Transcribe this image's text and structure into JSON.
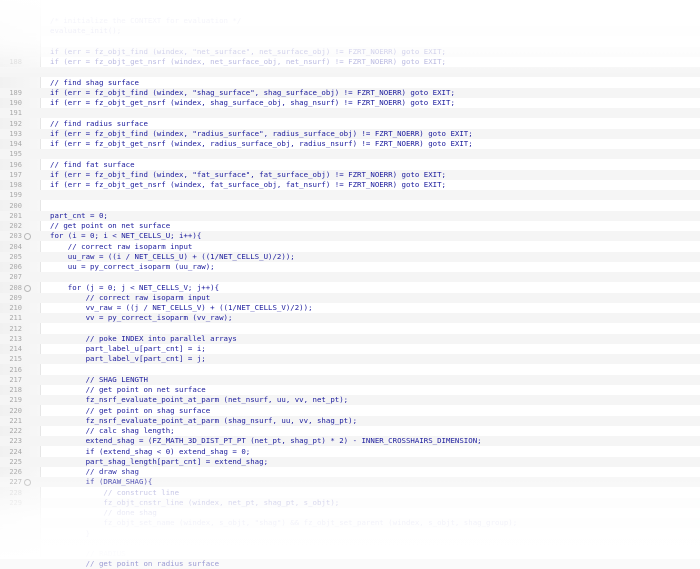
{
  "editor": {
    "lines": [
      {
        "n": "",
        "text": "/* initialize the CONTEXT for evaluation */",
        "dim": true
      },
      {
        "n": "",
        "text": "evaluate_init();",
        "dim": true
      },
      {
        "n": "",
        "text": "",
        "dim": true
      },
      {
        "n": "",
        "text": "if (err = fz_objt_find (windex, \"net_surface\", net_surface_obj) != FZRT_NOERR) goto EXIT;",
        "dim": true
      },
      {
        "n": "188",
        "text": "if (err = fz_objt_get_nsrf (windex, net_surface_obj, net_nsurf) != FZRT_NOERR) goto EXIT;",
        "dim": true
      },
      {
        "n": "",
        "text": ""
      },
      {
        "n": "",
        "text": "// find shag surface"
      },
      {
        "n": "189",
        "text": "if (err = fz_objt_find (windex, \"shag_surface\", shag_surface_obj) != FZRT_NOERR) goto EXIT;"
      },
      {
        "n": "190",
        "text": "if (err = fz_objt_get_nsrf (windex, shag_surface_obj, shag_nsurf) != FZRT_NOERR) goto EXIT;"
      },
      {
        "n": "191",
        "text": ""
      },
      {
        "n": "192",
        "text": "// find radius surface"
      },
      {
        "n": "193",
        "text": "if (err = fz_objt_find (windex, \"radius_surface\", radius_surface_obj) != FZRT_NOERR) goto EXIT;"
      },
      {
        "n": "194",
        "text": "if (err = fz_objt_get_nsrf (windex, radius_surface_obj, radius_nsurf) != FZRT_NOERR) goto EXIT;"
      },
      {
        "n": "195",
        "text": ""
      },
      {
        "n": "196",
        "text": "// find fat surface"
      },
      {
        "n": "197",
        "text": "if (err = fz_objt_find (windex, \"fat_surface\", fat_surface_obj) != FZRT_NOERR) goto EXIT;"
      },
      {
        "n": "198",
        "text": "if (err = fz_objt_get_nsrf (windex, fat_surface_obj, fat_nsurf) != FZRT_NOERR) goto EXIT;"
      },
      {
        "n": "199",
        "text": ""
      },
      {
        "n": "200",
        "text": ""
      },
      {
        "n": "201",
        "text": "part_cnt = 0;"
      },
      {
        "n": "202",
        "text": "// get point on net surface"
      },
      {
        "n": "203",
        "text": "for (i = 0; i < NET_CELLS_U; i++){",
        "fold": true
      },
      {
        "n": "204",
        "text": "    // correct raw isoparm input"
      },
      {
        "n": "205",
        "text": "    uu_raw = ((i / NET_CELLS_U) + ((1/NET_CELLS_U)/2));"
      },
      {
        "n": "206",
        "text": "    uu = py_correct_isoparm (uu_raw);"
      },
      {
        "n": "207",
        "text": ""
      },
      {
        "n": "208",
        "text": "    for (j = 0; j < NET_CELLS_V; j++){",
        "fold": true
      },
      {
        "n": "209",
        "text": "        // correct raw isoparm input"
      },
      {
        "n": "210",
        "text": "        vv_raw = ((j / NET_CELLS_V) + ((1/NET_CELLS_V)/2));"
      },
      {
        "n": "211",
        "text": "        vv = py_correct_isoparm (vv_raw);"
      },
      {
        "n": "212",
        "text": ""
      },
      {
        "n": "213",
        "text": "        // poke INDEX into parallel arrays"
      },
      {
        "n": "214",
        "text": "        part_label_u[part_cnt] = i;"
      },
      {
        "n": "215",
        "text": "        part_label_v[part_cnt] = j;"
      },
      {
        "n": "216",
        "text": ""
      },
      {
        "n": "217",
        "text": "        // SHAG LENGTH"
      },
      {
        "n": "218",
        "text": "        // get point on net surface"
      },
      {
        "n": "219",
        "text": "        fz_nsrf_evaluate_point_at_parm (net_nsurf, uu, vv, net_pt);"
      },
      {
        "n": "220",
        "text": "        // get point on shag surface"
      },
      {
        "n": "221",
        "text": "        fz_nsrf_evaluate_point_at_parm (shag_nsurf, uu, vv, shag_pt);"
      },
      {
        "n": "222",
        "text": "        // calc shag length;"
      },
      {
        "n": "223",
        "text": "        extend_shag = (FZ_MATH_3D_DIST_PT_PT (net_pt, shag_pt) * 2) - INNER_CROSSHAIRS_DIMENSION;"
      },
      {
        "n": "224",
        "text": "        if (extend_shag < 0) extend_shag = 0;"
      },
      {
        "n": "225",
        "text": "        part_shag_length[part_cnt] = extend_shag;"
      },
      {
        "n": "226",
        "text": "        // draw shag"
      },
      {
        "n": "227",
        "text": "        if (DRAW_SHAG){",
        "fold": true
      },
      {
        "n": "228",
        "text": "            // construct line",
        "dim": true
      },
      {
        "n": "229",
        "text": "            fz_objt_cnstr_line (windex, net_pt, shag_pt, s_objt);",
        "dim": true
      },
      {
        "n": "",
        "text": "            // done shag",
        "dim": true
      },
      {
        "n": "",
        "text": "            fz_objt_set_name (windex, s_objt, \"shag\") && fz_objt_set_parent (windex, s_objt, shag_group);",
        "dim": true
      },
      {
        "n": "",
        "text": "        }",
        "dim": true
      },
      {
        "n": "",
        "text": "",
        "dim": true
      },
      {
        "n": "",
        "text": "        // RADIUS",
        "dim": true
      },
      {
        "n": "",
        "text": "        // get point on radius surface",
        "dim": true
      }
    ]
  }
}
